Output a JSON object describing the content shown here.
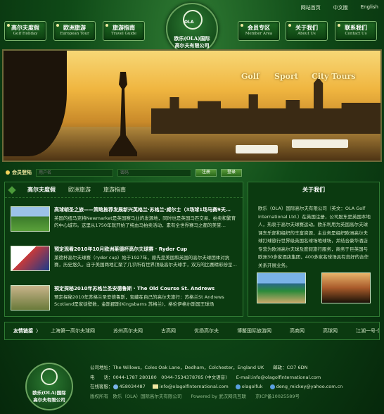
{
  "top_links": [
    "网站首页",
    "中文版",
    "English"
  ],
  "nav_left": [
    {
      "cn": "高尔夫度假",
      "en": "Golf Holiday"
    },
    {
      "cn": "欧洲旅游",
      "en": "European Tour"
    },
    {
      "cn": "旅游指南",
      "en": "Travel Guide"
    }
  ],
  "nav_right": [
    {
      "cn": "会员专区",
      "en": "Member Area"
    },
    {
      "cn": "关于我们",
      "en": "About Us"
    },
    {
      "cn": "联系我们",
      "en": "Contact Us"
    }
  ],
  "logo": {
    "mark": "OLA",
    "line1": "欧乐(OLA)国际",
    "line2": "高尔夫有限公司"
  },
  "banner": {
    "tags": [
      "Golf",
      "Sport",
      "City Tours"
    ]
  },
  "login": {
    "label": "会员登陆",
    "username_placeholder": "用户名",
    "password_placeholder": "密码",
    "register_btn": "注册",
    "login_btn": "登录"
  },
  "tabs": [
    "高尔夫度假",
    "欧洲旅游",
    "旅游指南"
  ],
  "news": [
    {
      "title": "高球朝圣之旅——策略推荐发展新兴英格兰·苏格兰·威尔士（3场球1场马赛9天…",
      "desc": "英国的纽马克特Newmarket是英国赛马业的发源地，同时也是英国马匹交易、拍卖和繁育的中心城市。这里从1750年就开始了纯血马拍卖活动，素有全世界赛马之都的美誉…"
    },
    {
      "title": "预定观看2010年10月欧洲莱德杯高尔夫球赛 · Ryder Cup",
      "desc": "莱德杯高尔夫球赛（ryder cup）始于1927年，原先是美国和英国的高尔夫球团体对抗赛，历史悠久。自于美国两地汇聚了几乎所有世界顶级高尔夫球手，双方的比赛精彩纷呈…"
    },
    {
      "title": "预定探秘2010年苏格兰圣安德鲁斯 · The Old Course St. Andrews",
      "desc": "预定探秘2010年苏格兰圣安德鲁斯，宝藏在自己的高尔夫旅行：苏格兰St Andrews Scotland是家徒壁数，金斯郡斯(Kingsbarns 苏格兰)，格伦伊格尔斯国王球场"
    }
  ],
  "about": {
    "title": "关于我们",
    "text": "欧乐（OLA）国际高尔夫有限公司（英文：OLA Golf International Ltd.）在英国注册，公司股东是英国本地人，热衷于高尔夫球赛运动。欧乐利用为英国高尔夫球课东乐部和组织的丰富资源，主业务是组织欧洲高尔夫球打球旅行世界级英国名球场地球场，并结合豪华酒店专营为欧洲高尔夫球及度假旅行服务，商务于巨英国与欧洲30多家酒店集团，400多家名球场具有良好的合作关系开展业务。"
  },
  "friends": {
    "label": "友情链接",
    "arrow": "〉",
    "links": [
      "上海第一高尔夫球网",
      "苏州高尔夫网",
      "古高网",
      "优扬高尔夫",
      "博鳌国际旅游网",
      "高商网",
      "高球网",
      "江湖一号·休闲会所"
    ]
  },
  "footer": {
    "logo_line1": "欧乐(OLA)国际",
    "logo_line2": "高尔夫有限公司",
    "address": "公司地址：The Willows，Coles Oak Lane，Dedham，Colchester，England UK　　邮政：CO7 6DN",
    "contact": "电　　话：0044-1787 280180　0044-7534378785 (中文语音)　　E-mail:info@olagolfinternational.com",
    "online_label": "在线客服：",
    "qq": "458034487",
    "email": "info@olagolfinternational.com",
    "skype": "olagolfuk",
    "msn": "deng_mickey@yahoo.com.cn",
    "copyright": "版权所有　欧乐（OLA）国际高尔夫有限公司　　Powered by 武汉网讯互联　　京ICP备10025589号"
  }
}
